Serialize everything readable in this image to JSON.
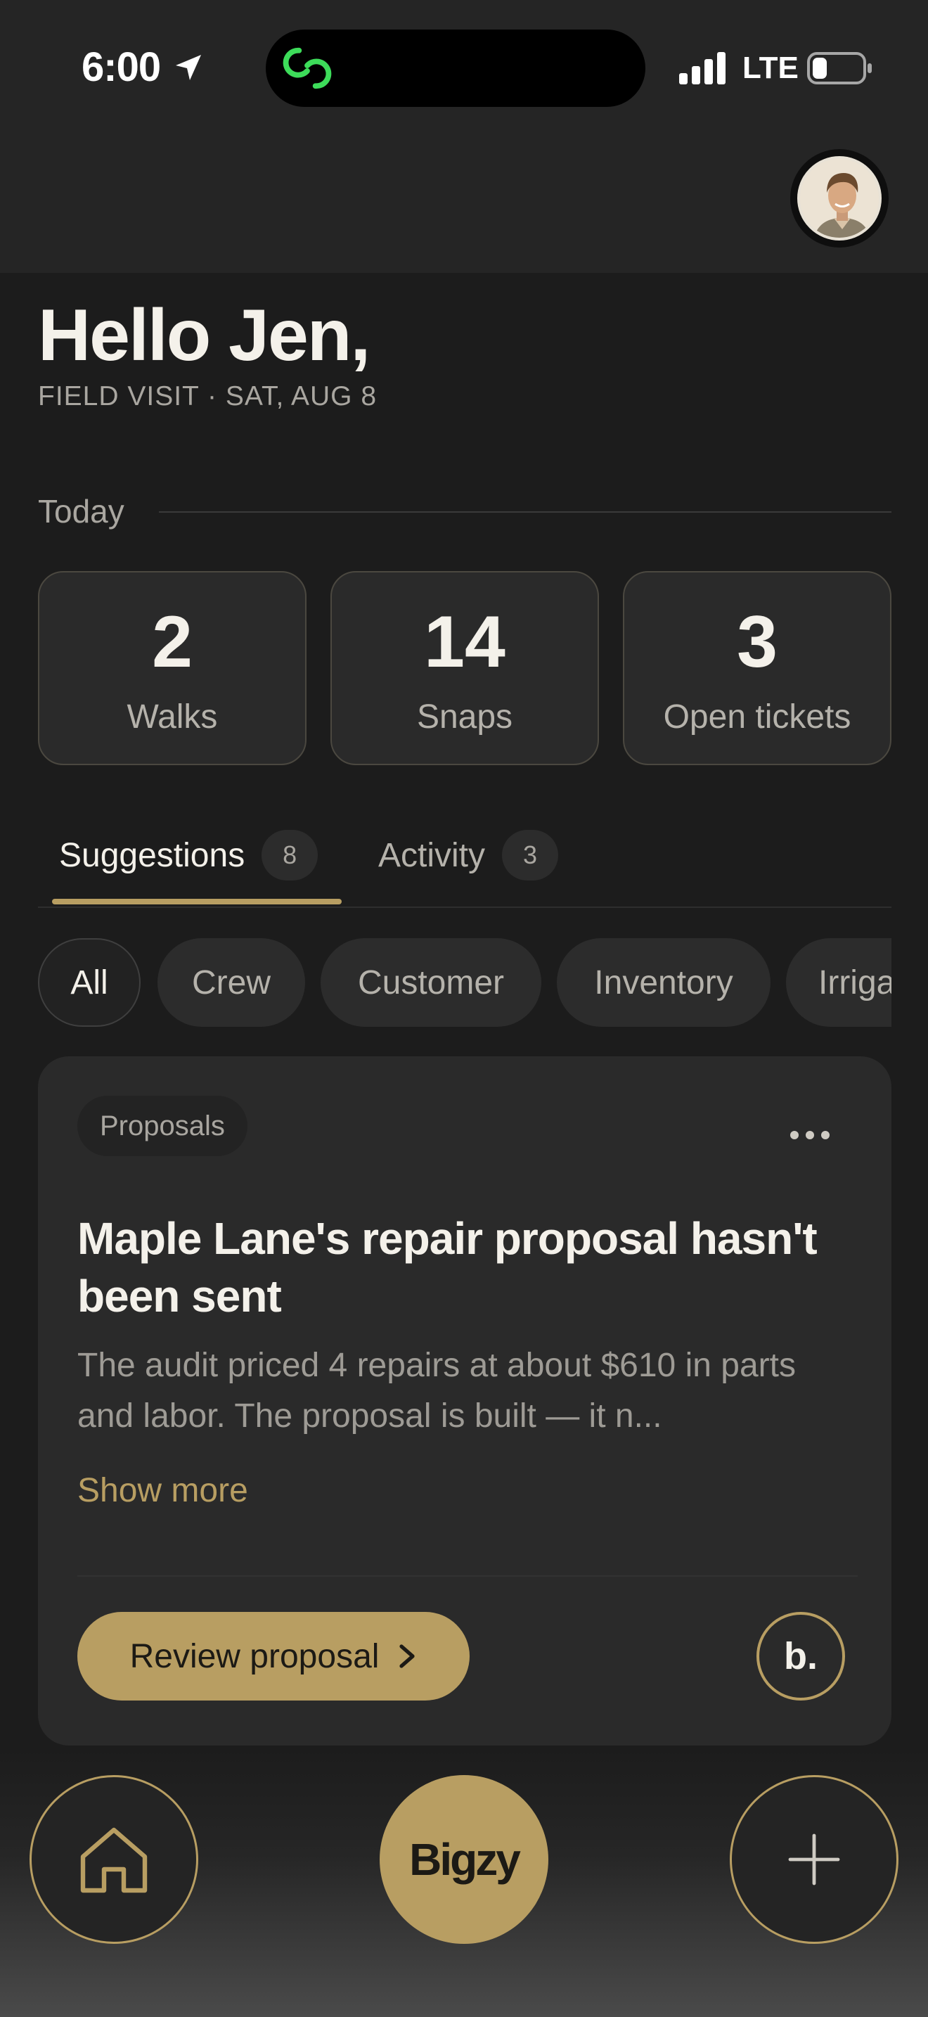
{
  "status_bar": {
    "time": "6:00",
    "network": "LTE"
  },
  "greeting": "Hello Jen,",
  "subgreeting": "FIELD VISIT · SAT, AUG 8",
  "today": {
    "label": "Today",
    "stats": [
      {
        "value": "2",
        "label": "Walks"
      },
      {
        "value": "14",
        "label": "Snaps"
      },
      {
        "value": "3",
        "label": "Open tickets"
      }
    ]
  },
  "tabs": [
    {
      "label": "Suggestions",
      "count": "8",
      "active": true
    },
    {
      "label": "Activity",
      "count": "3",
      "active": false
    }
  ],
  "filters": [
    "All",
    "Crew",
    "Customer",
    "Inventory",
    "Irriga"
  ],
  "card": {
    "tag": "Proposals",
    "title": "Maple Lane's repair proposal hasn't been sent",
    "body": "The audit priced 4 repairs at about $610 in parts and labor. The proposal is built — it n...",
    "show_more": "Show more",
    "action_label": "Review proposal",
    "badge": "b."
  },
  "bottom_nav": {
    "center_label": "Bigzy"
  },
  "colors": {
    "accent": "#b89e62",
    "background": "#1c1c1c",
    "card": "#2a2a2a",
    "status_icon": "#3ddc5a"
  }
}
